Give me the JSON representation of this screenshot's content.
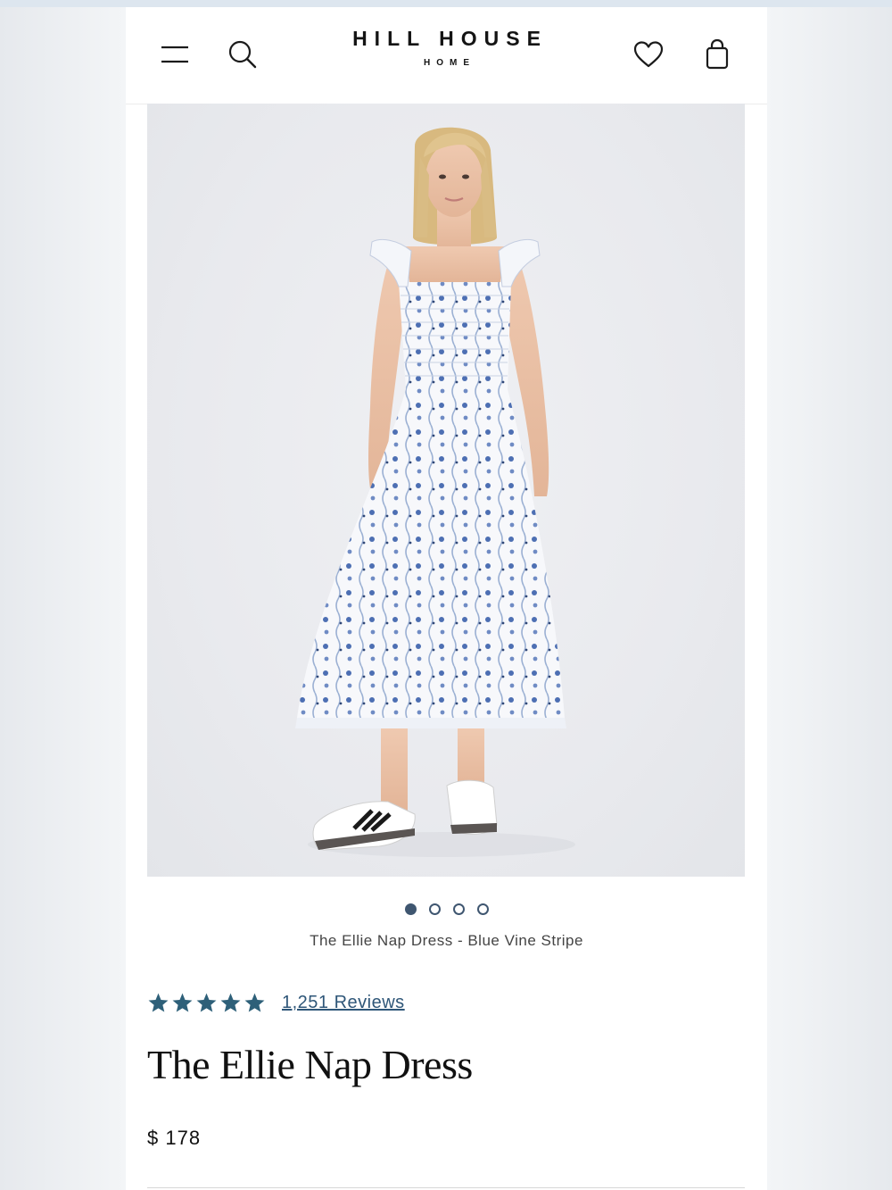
{
  "header": {
    "logo_main": "HILL HOUSE",
    "logo_sub": "HOME",
    "icons": [
      "menu-icon",
      "search-icon",
      "heart-icon",
      "shopping-bag-icon"
    ]
  },
  "product": {
    "image_caption": "The Ellie Nap Dress - Blue Vine Stripe",
    "carousel": {
      "total": 4,
      "active_index": 0
    },
    "rating": {
      "stars": 5,
      "reviews_label": "1,251 Reviews"
    },
    "title": "The Ellie Nap Dress",
    "price": "$ 178"
  },
  "colors": {
    "accent": "#2e5678",
    "dot_active": "#3f5670",
    "star": "#2e6079"
  }
}
